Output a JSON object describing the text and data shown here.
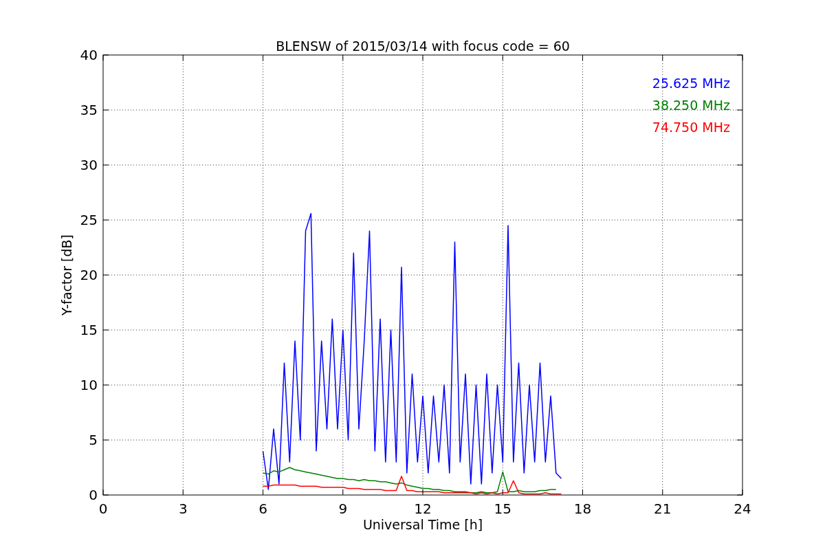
{
  "chart_data": {
    "type": "line",
    "title": "BLENSW of 2015/03/14 with focus code = 60",
    "xlabel": "Universal Time [h]",
    "ylabel": "Y-factor [dB]",
    "x": [
      6,
      6.2,
      6.4,
      6.6,
      6.8,
      7,
      7.2,
      7.4,
      7.6,
      7.8,
      8,
      8.2,
      8.4,
      8.6,
      8.8,
      9,
      9.2,
      9.4,
      9.6,
      9.8,
      10,
      10.2,
      10.4,
      10.6,
      10.8,
      11,
      11.2,
      11.4,
      11.6,
      11.8,
      12,
      12.2,
      12.4,
      12.6,
      12.8,
      13,
      13.2,
      13.4,
      13.6,
      13.8,
      14,
      14.2,
      14.4,
      14.6,
      14.8,
      15,
      15.2,
      15.4,
      15.6,
      15.8,
      16,
      16.2,
      16.4,
      16.6,
      16.8,
      17,
      17.2
    ],
    "series": [
      {
        "name": "25.625 MHz",
        "color": "#0000ff",
        "values": [
          4,
          0.5,
          6,
          1,
          12,
          3,
          14,
          5,
          24,
          25.6,
          4,
          14,
          6,
          16,
          6,
          15,
          5,
          22,
          6,
          14,
          24,
          4,
          16,
          3,
          15,
          3,
          20.7,
          2,
          11,
          3,
          9,
          2,
          9,
          3,
          10,
          2,
          23,
          3,
          11,
          1,
          10,
          1,
          11,
          2,
          10,
          3,
          24.5,
          3,
          12,
          2,
          10,
          3,
          12,
          3,
          9,
          2,
          1.5
        ]
      },
      {
        "name": "38.250 MHz",
        "color": "#008000",
        "values": [
          2,
          1.9,
          2.2,
          2.1,
          2.3,
          2.5,
          2.3,
          2.2,
          2.1,
          2,
          1.9,
          1.8,
          1.7,
          1.6,
          1.5,
          1.5,
          1.4,
          1.4,
          1.3,
          1.4,
          1.3,
          1.3,
          1.2,
          1.2,
          1.1,
          1,
          1.1,
          0.9,
          0.8,
          0.7,
          0.6,
          0.6,
          0.5,
          0.5,
          0.4,
          0.4,
          0.3,
          0.3,
          0.3,
          0.2,
          0.2,
          0.3,
          0.2,
          0.2,
          0.3,
          2.1,
          0.3,
          0.3,
          0.4,
          0.3,
          0.3,
          0.3,
          0.4,
          0.4,
          0.5,
          0.5,
          null
        ]
      },
      {
        "name": "74.750 MHz",
        "color": "#ff0000",
        "values": [
          0.8,
          0.8,
          0.9,
          0.9,
          0.9,
          0.9,
          0.9,
          0.8,
          0.8,
          0.8,
          0.8,
          0.7,
          0.7,
          0.7,
          0.7,
          0.7,
          0.6,
          0.6,
          0.6,
          0.5,
          0.5,
          0.5,
          0.5,
          0.4,
          0.4,
          0.4,
          1.7,
          0.4,
          0.4,
          0.3,
          0.3,
          0.3,
          0.3,
          0.3,
          0.2,
          0.2,
          0.2,
          0.2,
          0.2,
          0.2,
          0.1,
          0.2,
          0.1,
          0.2,
          0.1,
          0.2,
          0.2,
          1.3,
          0.2,
          0.1,
          0.1,
          0.1,
          0.1,
          0.2,
          0.1,
          0.1,
          0.1
        ]
      }
    ],
    "xlim": [
      0,
      24
    ],
    "ylim": [
      0,
      40
    ],
    "xticks": [
      0,
      3,
      6,
      9,
      12,
      15,
      18,
      21,
      24
    ],
    "yticks": [
      0,
      5,
      10,
      15,
      20,
      25,
      30,
      35,
      40
    ],
    "grid": true
  }
}
